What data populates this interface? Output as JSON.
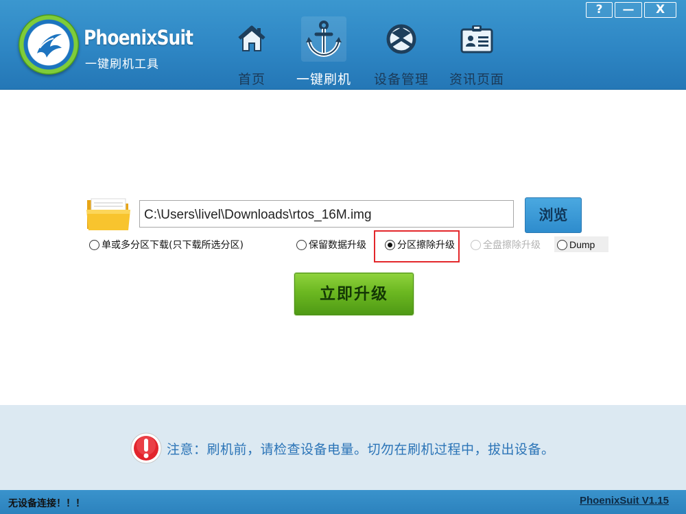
{
  "header": {
    "app_name": "PhoenixSuit",
    "app_subtitle": "一键刷机工具",
    "tabs": [
      {
        "label": "首页",
        "icon": "home-icon",
        "active": false
      },
      {
        "label": "一键刷机",
        "icon": "anchor-icon",
        "active": true
      },
      {
        "label": "设备管理",
        "icon": "device-icon",
        "active": false
      },
      {
        "label": "资讯页面",
        "icon": "news-card-icon",
        "active": false
      }
    ],
    "window_buttons": {
      "help": "?",
      "minimize": "—",
      "close": "X"
    }
  },
  "flash": {
    "file_path": "C:\\Users\\livel\\Downloads\\rtos_16M.img",
    "browse_label": "浏览",
    "options": [
      {
        "label": "单或多分区下载(只下载所选分区)",
        "checked": false,
        "disabled": false
      },
      {
        "label": "保留数据升级",
        "checked": false,
        "disabled": false
      },
      {
        "label": "分区擦除升级",
        "checked": true,
        "disabled": false
      },
      {
        "label": "全盘擦除升级",
        "checked": false,
        "disabled": true
      },
      {
        "label": "Dump",
        "checked": false,
        "disabled": false
      }
    ],
    "upgrade_label": "立即升级"
  },
  "notice": {
    "text": "注意：刷机前，请检查设备电量。切勿在刷机过程中，拔出设备。"
  },
  "status": {
    "connection": "无设备连接！！！",
    "version": "PhoenixSuit V1.15"
  },
  "colors": {
    "header_bg": "#2e86c4",
    "upgrade_green": "#6cb821",
    "highlight_red": "#e3262a",
    "notice_text": "#2b74b7"
  }
}
